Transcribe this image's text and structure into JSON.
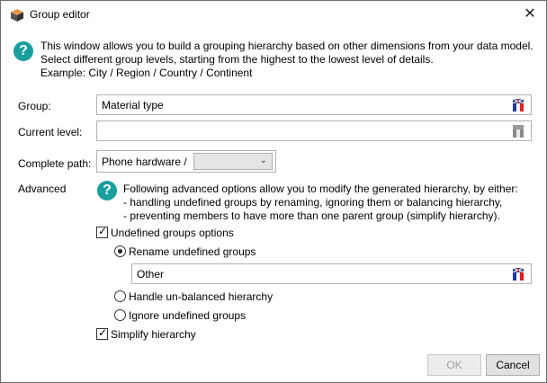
{
  "window": {
    "title": "Group editor",
    "close_glyph": "✕"
  },
  "intro": {
    "lines": [
      "This window allows you to build a grouping hierarchy based on other dimensions from your data model.",
      "Select different group levels, starting from the highest to the lowest level of details.",
      "Example: City / Region / Country / Continent"
    ]
  },
  "form": {
    "group_label": "Group:",
    "group_value": "Material type",
    "current_level_label": "Current level:",
    "current_level_value": "",
    "complete_path_label": "Complete path:",
    "complete_path_value": "Phone hardware  /",
    "path_dropdown_value": ""
  },
  "advanced": {
    "label": "Advanced",
    "lines": [
      "Following advanced options allow you to modify the generated hierarchy, by either:",
      "- handling undefined groups by renaming, ignoring them or balancing hierarchy,",
      "- preventing members to have more than one parent group (simplify hierarchy)."
    ],
    "undefined_groups_options": {
      "label": "Undefined groups options",
      "checked": true
    },
    "rename_undefined": {
      "label": "Rename undefined groups",
      "selected": true
    },
    "rename_value": "Other",
    "unbalanced": {
      "label": "Handle un-balanced hierarchy",
      "selected": false
    },
    "ignore_undefined": {
      "label": "Ignore undefined groups",
      "selected": false
    },
    "simplify": {
      "label": "Simplify hierarchy",
      "checked": true
    }
  },
  "buttons": {
    "ok": "OK",
    "cancel": "Cancel"
  },
  "icons": {
    "app": "app-cube-icon",
    "help": "help-circle-icon",
    "flag": "language-flag-icon"
  },
  "colors": {
    "help_accent": "#1b9e9e"
  }
}
